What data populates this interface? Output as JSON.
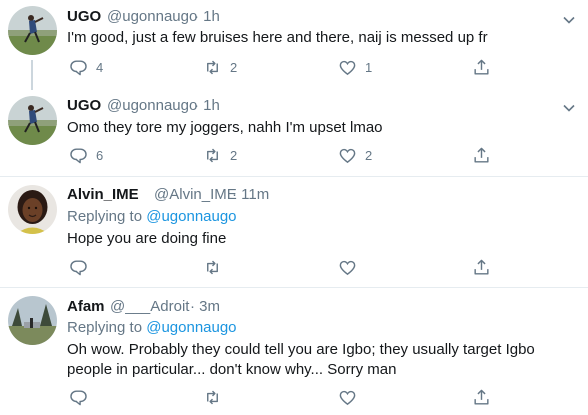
{
  "tweets": [
    {
      "name": "UGO",
      "handle": "@ugonnaugo",
      "time": "· 1h",
      "text": "I'm good, just a few bruises here and there, naij is messed up fr",
      "replies": "4",
      "retweets": "2",
      "likes": "1"
    },
    {
      "name": "UGO",
      "handle": "@ugonnaugo",
      "time": "· 1h",
      "text": "Omo they tore my joggers, nahh I'm upset lmao",
      "replies": "6",
      "retweets": "2",
      "likes": "2"
    },
    {
      "name": "Alvin_IME",
      "handle": "@Alvin_IME",
      "time": "· 11m",
      "replying_label": "Replying to",
      "replying_to": "@ugonnaugo",
      "text": "Hope you are doing fine",
      "replies": "",
      "retweets": "",
      "likes": ""
    },
    {
      "name": "Afam",
      "handle": "@___Adroit",
      "time": "· 3m",
      "replying_label": "Replying to",
      "replying_to": "@ugonnaugo",
      "text": "Oh wow. Probably they could tell you are Igbo; they usually target Igbo people in particular... don't know why... Sorry man",
      "replies": "",
      "retweets": "",
      "likes": ""
    }
  ],
  "colors": {
    "text": "#14171a",
    "secondary": "#657786",
    "link": "#1b95e0",
    "divider": "#e6ecf0"
  },
  "icons": [
    "reply-icon",
    "retweet-icon",
    "like-icon",
    "share-icon",
    "chevron-down-icon"
  ]
}
